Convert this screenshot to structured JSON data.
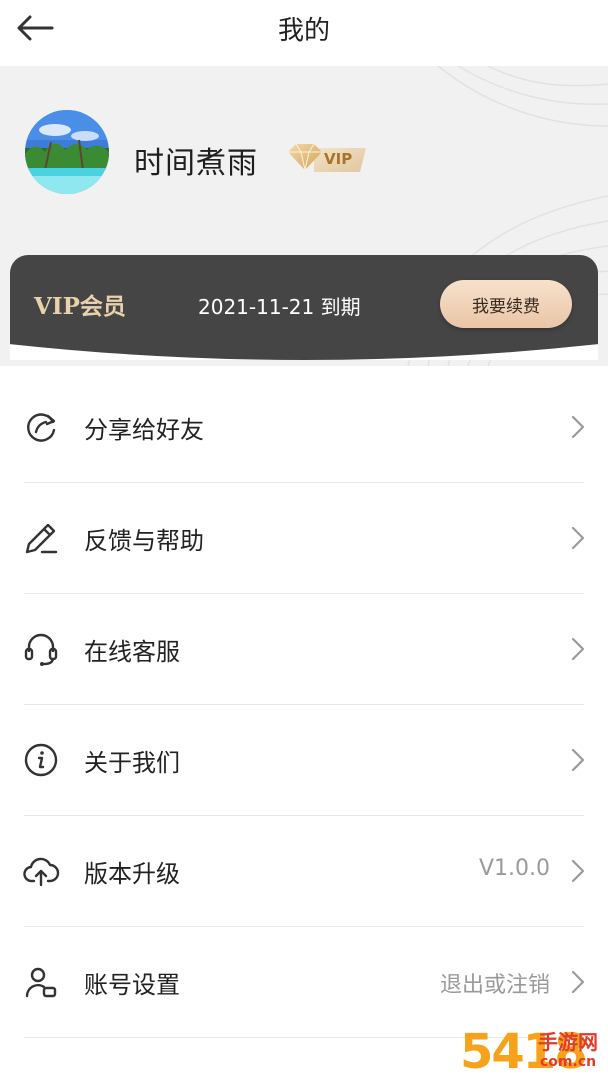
{
  "header": {
    "title": "我的",
    "back_icon": "arrow-left-icon"
  },
  "profile": {
    "username": "时间煮雨",
    "vip_badge": "VIP"
  },
  "vip_card": {
    "title": "VIP会员",
    "expire_text": "2021-11-21 到期",
    "renew_label": "我要续费"
  },
  "menu": {
    "items": [
      {
        "label": "分享给好友",
        "icon": "share-icon",
        "value": ""
      },
      {
        "label": "反馈与帮助",
        "icon": "pencil-icon",
        "value": ""
      },
      {
        "label": "在线客服",
        "icon": "headset-icon",
        "value": ""
      },
      {
        "label": "关于我们",
        "icon": "info-icon",
        "value": ""
      },
      {
        "label": "版本升级",
        "icon": "cloud-upload-icon",
        "value": "V1.0.0"
      },
      {
        "label": "账号设置",
        "icon": "user-settings-icon",
        "value": "退出或注销"
      }
    ]
  },
  "watermark": {
    "number": "5418",
    "text": "手游网",
    "domain": "com.cn"
  },
  "colors": {
    "vip_card_bg": "#464545",
    "vip_gold": "#e8d2ad",
    "renew_btn": "#efd2b6"
  }
}
